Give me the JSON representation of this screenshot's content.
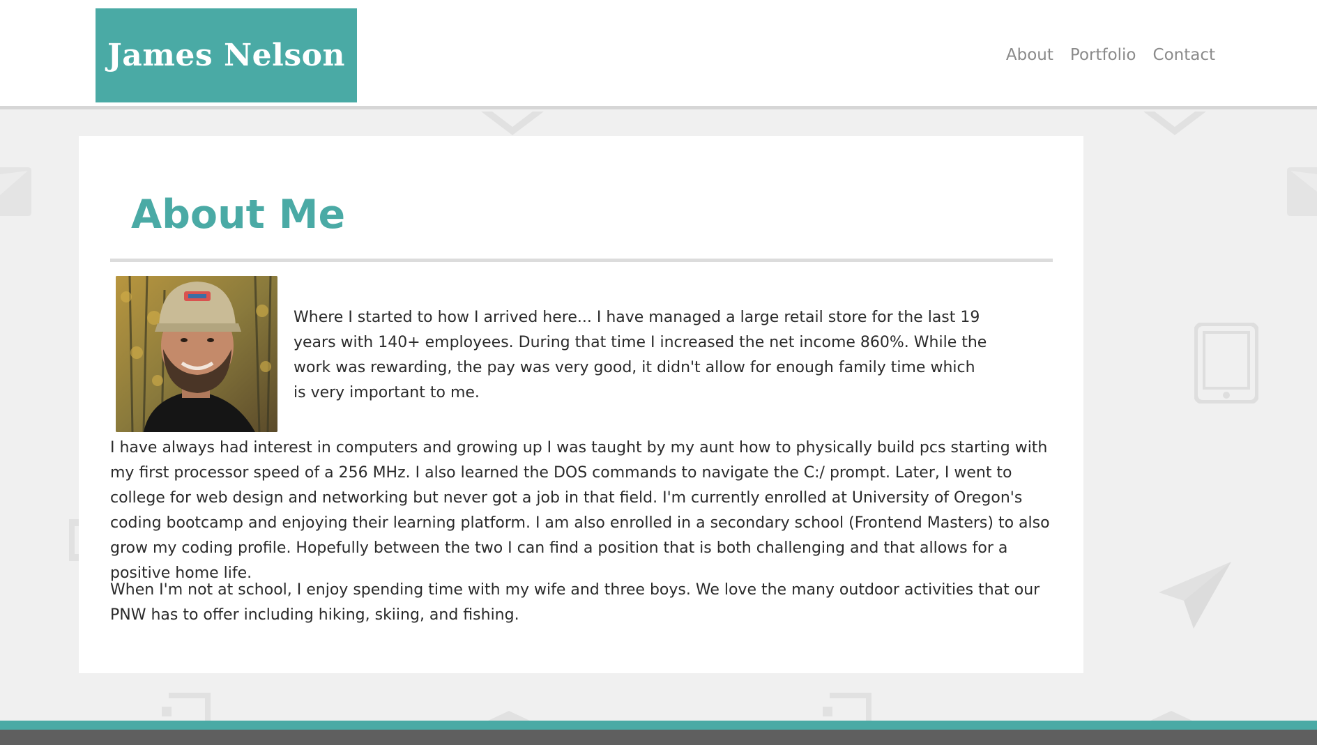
{
  "header": {
    "logo_text": "James Nelson",
    "nav": [
      {
        "label": "About"
      },
      {
        "label": "Portfolio"
      },
      {
        "label": "Contact"
      }
    ]
  },
  "main": {
    "title": "About Me",
    "photo_alt": "Photo of James Nelson",
    "paragraphs": [
      "Where I started to how I arrived here... I have managed a large retail store for the last 19 years with 140+ employees. During that time I increased the net income 860%. While the work was rewarding, the pay was very good, it didn't allow for enough family time which is very important to me.",
      "I have always had interest in computers and growing up I was taught by my aunt how to physically build pcs starting with my first processor speed of a 256 MHz. I also learned the DOS commands to navigate the C:/ prompt. Later, I went to college for web design and networking but never got a job in that field. I'm currently enrolled at University of Oregon's coding bootcamp and enjoying their learning platform. I am also enrolled in a secondary school (Frontend Masters) to also grow my coding profile. Hopefully between the two I can find a position that is both challenging and that allows for a positive home life.",
      "When I'm not at school, I enjoy spending time with my wife and three boys. We love the many outdoor activities that our PNW has to offer including hiking, skiing, and fishing."
    ]
  },
  "colors": {
    "accent": "#4aaaa5",
    "footer": "#5f5f5f",
    "background": "#f0f0f0"
  },
  "icons": [
    "envelope-icon",
    "tablet-icon",
    "paper-plane-icon",
    "chevron-icon",
    "bracket-icon"
  ]
}
